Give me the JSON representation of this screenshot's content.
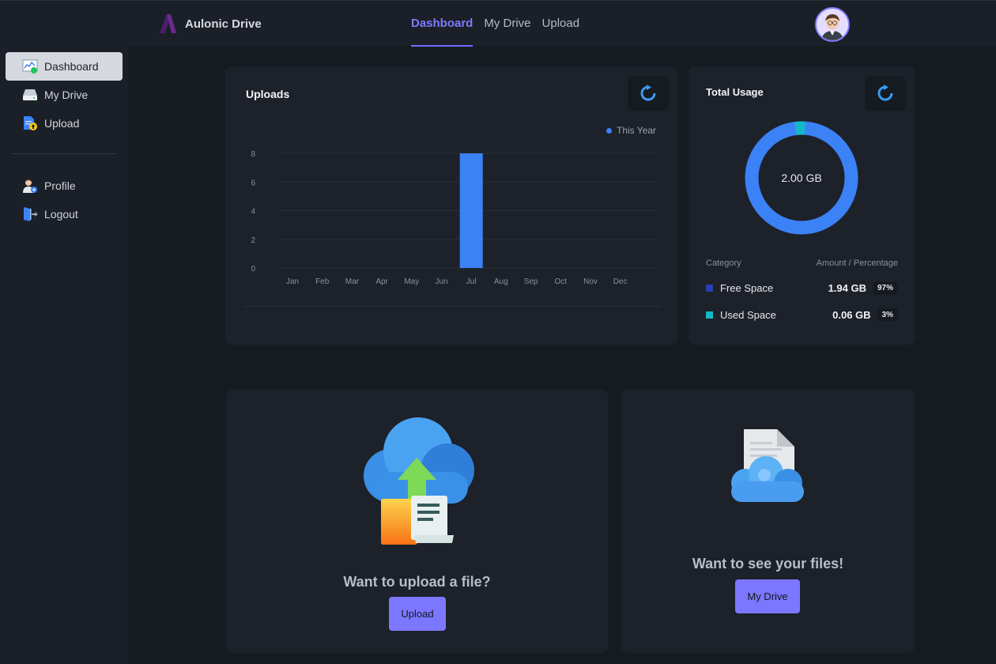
{
  "app": {
    "name": "Aulonic Drive"
  },
  "topnav": [
    {
      "label": "Dashboard",
      "active": true
    },
    {
      "label": "My Drive",
      "active": false
    },
    {
      "label": "Upload",
      "active": false
    }
  ],
  "sidebar": {
    "items": [
      {
        "label": "Dashboard",
        "icon": "dashboard-icon",
        "active": true
      },
      {
        "label": "My Drive",
        "icon": "drive-icon",
        "active": false
      },
      {
        "label": "Upload",
        "icon": "upload-file-icon",
        "active": false
      },
      {
        "label": "Profile",
        "icon": "profile-icon",
        "active": false
      },
      {
        "label": "Logout",
        "icon": "logout-icon",
        "active": false
      }
    ]
  },
  "uploads_card": {
    "title": "Uploads",
    "legend": "This Year"
  },
  "chart_data": {
    "type": "bar",
    "categories": [
      "Jan",
      "Feb",
      "Mar",
      "Apr",
      "May",
      "Jun",
      "Jul",
      "Aug",
      "Sep",
      "Oct",
      "Nov",
      "Dec"
    ],
    "series": [
      {
        "name": "This Year",
        "values": [
          0,
          0,
          0,
          0,
          0,
          0,
          8,
          0,
          0,
          0,
          0,
          0
        ]
      }
    ],
    "yticks": [
      0,
      2,
      4,
      6,
      8
    ],
    "ylim": [
      0,
      8
    ],
    "title": "Uploads",
    "legend_position": "top-right",
    "grid": true,
    "color": "#3b82f6"
  },
  "usage_card": {
    "title": "Total Usage",
    "center_label": "2.00 GB",
    "header_category": "Category",
    "header_amount": "Amount / Percentage",
    "rows": [
      {
        "category": "Free Space",
        "amount": "1.94 GB",
        "percent": "97%",
        "color": "#2b3fb0",
        "fraction": 0.97
      },
      {
        "category": "Used Space",
        "amount": "0.06 GB",
        "percent": "3%",
        "color": "#14b8c8",
        "fraction": 0.03
      }
    ],
    "ring_color": "#3b82f6",
    "used_color": "#14b8c8"
  },
  "upload_promo": {
    "text": "Want to upload a file?",
    "button": "Upload"
  },
  "drive_promo": {
    "text": "Want to see your files!",
    "button": "My Drive"
  },
  "colors": {
    "accent": "#7b78ff",
    "bar": "#3b82f6"
  }
}
